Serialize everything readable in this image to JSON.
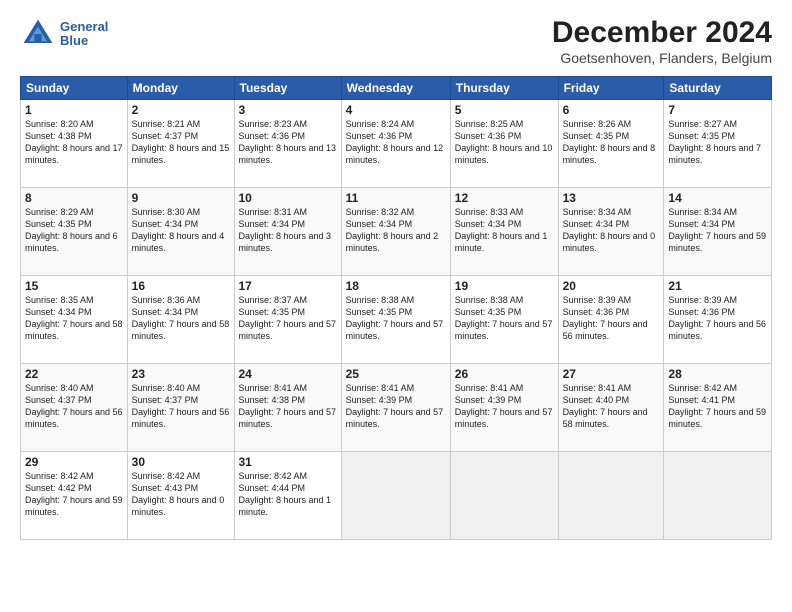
{
  "header": {
    "logo_line1": "General",
    "logo_line2": "Blue",
    "month_title": "December 2024",
    "location": "Goetsenhoven, Flanders, Belgium"
  },
  "weekdays": [
    "Sunday",
    "Monday",
    "Tuesday",
    "Wednesday",
    "Thursday",
    "Friday",
    "Saturday"
  ],
  "weeks": [
    [
      {
        "day": "1",
        "info": "Sunrise: 8:20 AM\nSunset: 4:38 PM\nDaylight: 8 hours and 17 minutes."
      },
      {
        "day": "2",
        "info": "Sunrise: 8:21 AM\nSunset: 4:37 PM\nDaylight: 8 hours and 15 minutes."
      },
      {
        "day": "3",
        "info": "Sunrise: 8:23 AM\nSunset: 4:36 PM\nDaylight: 8 hours and 13 minutes."
      },
      {
        "day": "4",
        "info": "Sunrise: 8:24 AM\nSunset: 4:36 PM\nDaylight: 8 hours and 12 minutes."
      },
      {
        "day": "5",
        "info": "Sunrise: 8:25 AM\nSunset: 4:36 PM\nDaylight: 8 hours and 10 minutes."
      },
      {
        "day": "6",
        "info": "Sunrise: 8:26 AM\nSunset: 4:35 PM\nDaylight: 8 hours and 8 minutes."
      },
      {
        "day": "7",
        "info": "Sunrise: 8:27 AM\nSunset: 4:35 PM\nDaylight: 8 hours and 7 minutes."
      }
    ],
    [
      {
        "day": "8",
        "info": "Sunrise: 8:29 AM\nSunset: 4:35 PM\nDaylight: 8 hours and 6 minutes."
      },
      {
        "day": "9",
        "info": "Sunrise: 8:30 AM\nSunset: 4:34 PM\nDaylight: 8 hours and 4 minutes."
      },
      {
        "day": "10",
        "info": "Sunrise: 8:31 AM\nSunset: 4:34 PM\nDaylight: 8 hours and 3 minutes."
      },
      {
        "day": "11",
        "info": "Sunrise: 8:32 AM\nSunset: 4:34 PM\nDaylight: 8 hours and 2 minutes."
      },
      {
        "day": "12",
        "info": "Sunrise: 8:33 AM\nSunset: 4:34 PM\nDaylight: 8 hours and 1 minute."
      },
      {
        "day": "13",
        "info": "Sunrise: 8:34 AM\nSunset: 4:34 PM\nDaylight: 8 hours and 0 minutes."
      },
      {
        "day": "14",
        "info": "Sunrise: 8:34 AM\nSunset: 4:34 PM\nDaylight: 7 hours and 59 minutes."
      }
    ],
    [
      {
        "day": "15",
        "info": "Sunrise: 8:35 AM\nSunset: 4:34 PM\nDaylight: 7 hours and 58 minutes."
      },
      {
        "day": "16",
        "info": "Sunrise: 8:36 AM\nSunset: 4:34 PM\nDaylight: 7 hours and 58 minutes."
      },
      {
        "day": "17",
        "info": "Sunrise: 8:37 AM\nSunset: 4:35 PM\nDaylight: 7 hours and 57 minutes."
      },
      {
        "day": "18",
        "info": "Sunrise: 8:38 AM\nSunset: 4:35 PM\nDaylight: 7 hours and 57 minutes."
      },
      {
        "day": "19",
        "info": "Sunrise: 8:38 AM\nSunset: 4:35 PM\nDaylight: 7 hours and 57 minutes."
      },
      {
        "day": "20",
        "info": "Sunrise: 8:39 AM\nSunset: 4:36 PM\nDaylight: 7 hours and 56 minutes."
      },
      {
        "day": "21",
        "info": "Sunrise: 8:39 AM\nSunset: 4:36 PM\nDaylight: 7 hours and 56 minutes."
      }
    ],
    [
      {
        "day": "22",
        "info": "Sunrise: 8:40 AM\nSunset: 4:37 PM\nDaylight: 7 hours and 56 minutes."
      },
      {
        "day": "23",
        "info": "Sunrise: 8:40 AM\nSunset: 4:37 PM\nDaylight: 7 hours and 56 minutes."
      },
      {
        "day": "24",
        "info": "Sunrise: 8:41 AM\nSunset: 4:38 PM\nDaylight: 7 hours and 57 minutes."
      },
      {
        "day": "25",
        "info": "Sunrise: 8:41 AM\nSunset: 4:39 PM\nDaylight: 7 hours and 57 minutes."
      },
      {
        "day": "26",
        "info": "Sunrise: 8:41 AM\nSunset: 4:39 PM\nDaylight: 7 hours and 57 minutes."
      },
      {
        "day": "27",
        "info": "Sunrise: 8:41 AM\nSunset: 4:40 PM\nDaylight: 7 hours and 58 minutes."
      },
      {
        "day": "28",
        "info": "Sunrise: 8:42 AM\nSunset: 4:41 PM\nDaylight: 7 hours and 59 minutes."
      }
    ],
    [
      {
        "day": "29",
        "info": "Sunrise: 8:42 AM\nSunset: 4:42 PM\nDaylight: 7 hours and 59 minutes."
      },
      {
        "day": "30",
        "info": "Sunrise: 8:42 AM\nSunset: 4:43 PM\nDaylight: 8 hours and 0 minutes."
      },
      {
        "day": "31",
        "info": "Sunrise: 8:42 AM\nSunset: 4:44 PM\nDaylight: 8 hours and 1 minute."
      },
      null,
      null,
      null,
      null
    ]
  ]
}
